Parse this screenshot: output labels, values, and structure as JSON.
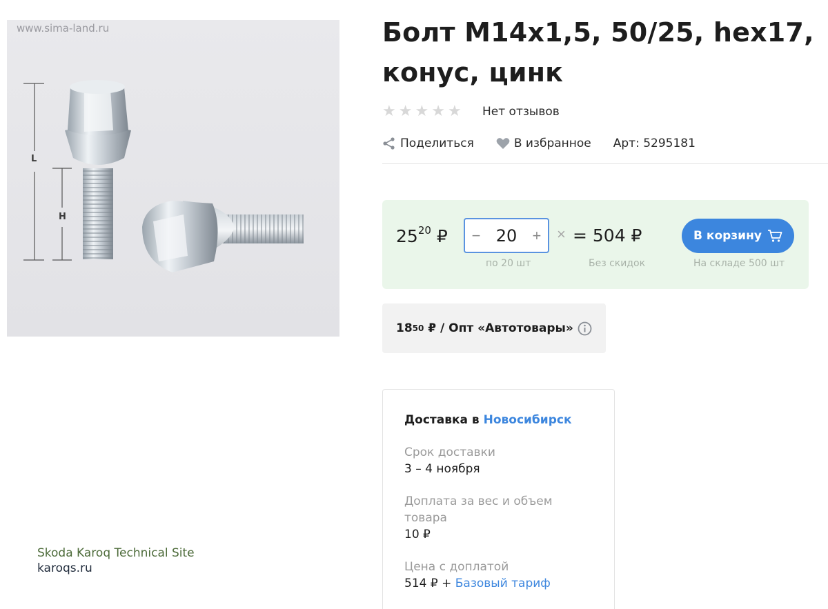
{
  "image": {
    "watermark": "www.sima-land.ru",
    "dim_l": "L",
    "dim_h": "H"
  },
  "product": {
    "title": "Болт М14х1,5, 50/25, hex17, конус, цинк",
    "rating": 0,
    "reviews_text": "Нет отзывов",
    "share_label": "Поделиться",
    "favorite_label": "В избранное",
    "article": "Арт: 5295181"
  },
  "pricing": {
    "price_int": "25",
    "price_frac": "20",
    "currency": "₽",
    "quantity": "20",
    "times": "×",
    "total": "= 504 ₽",
    "cart_label": "В корзину",
    "pack_note": "по 20 шт",
    "discount_note": "Без скидок",
    "stock_note": "На складе 500 шт",
    "accent": "#3c86de",
    "block_bg": "#eaf6ea"
  },
  "wholesale": {
    "price_int": "18",
    "price_frac": "50",
    "text": "₽ / Опт «Автотовары»"
  },
  "delivery": {
    "title_prefix": "Доставка в",
    "city": "Новосибирск",
    "term_label": "Срок доставки",
    "term_value": "3 – 4 ноября",
    "surcharge_label": "Доплата за вес и объем товара",
    "surcharge_value": "10 ₽",
    "price_label": "Цена с доплатой",
    "price_value": "514 ₽ +",
    "tariff_link": "Базовый тариф"
  },
  "site_mark": {
    "line1": "Skoda Karoq Technical Site",
    "line2": "karoqs.ru"
  },
  "icons": [
    "star-icon",
    "share-icon",
    "heart-icon",
    "cart-icon",
    "info-icon",
    "minus-icon",
    "plus-icon"
  ]
}
